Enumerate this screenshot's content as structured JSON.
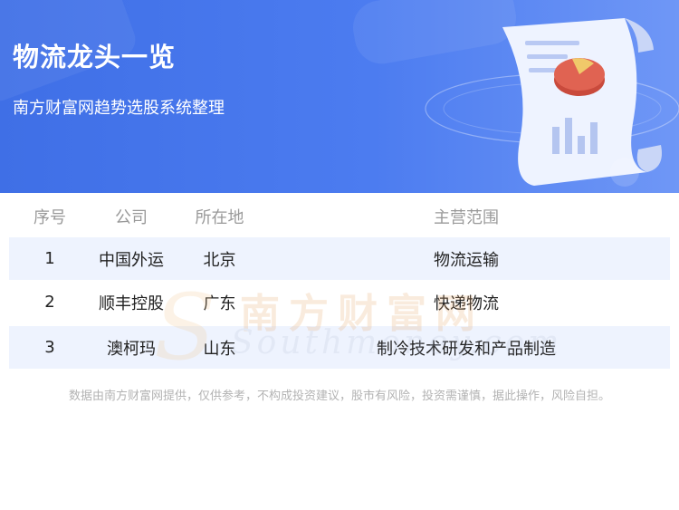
{
  "banner": {
    "title": "物流龙头一览",
    "subtitle": "南方财富网趋势选股系统整理"
  },
  "table": {
    "headers": [
      "序号",
      "公司",
      "所在地",
      "主营范围"
    ],
    "rows": [
      {
        "index": "1",
        "company": "中国外运",
        "location": "北京",
        "business": "物流运输"
      },
      {
        "index": "2",
        "company": "顺丰控股",
        "location": "广东",
        "business": "快递物流"
      },
      {
        "index": "3",
        "company": "澳柯玛",
        "location": "山东",
        "business": "制冷技术研发和产品制造"
      }
    ]
  },
  "watermark": {
    "text_cn": "南方财富网",
    "text_en": "Southmoney.com"
  },
  "footer": {
    "disclaimer": "数据由南方财富网提供，仅供参考，不构成投资建议，股市有风险，投资需谨慎，据此操作，风险自担。"
  },
  "colors": {
    "banner": "#4a78ee",
    "row_highlight": "#eef3fe",
    "header_text": "#999999"
  }
}
